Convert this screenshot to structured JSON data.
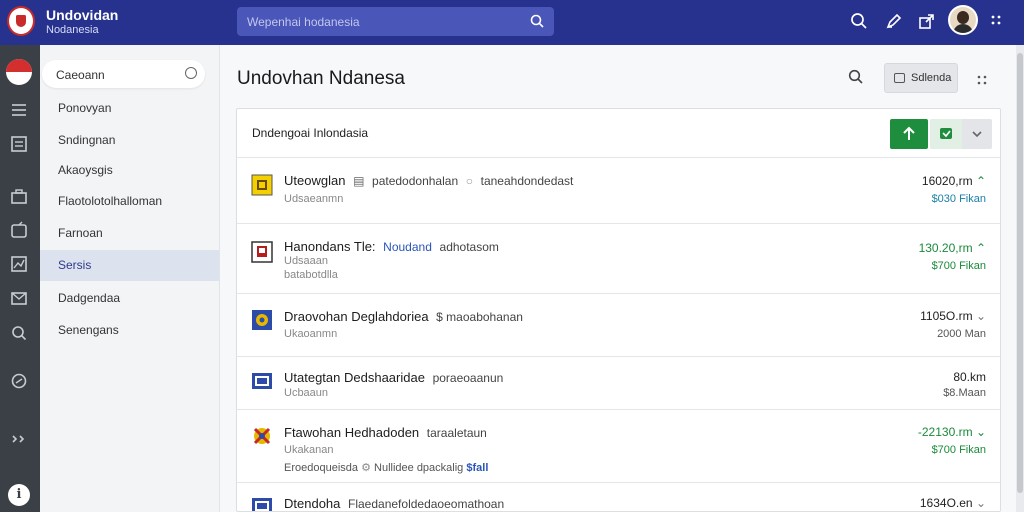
{
  "app": {
    "brand_line1": "Undovidan",
    "brand_line2": "Nodanesia"
  },
  "search": {
    "placeholder": "Wepenhai hodanesia"
  },
  "topbar_icons": [
    "search-icon",
    "edit-icon",
    "share-icon",
    "avatar",
    "apps-grid-icon"
  ],
  "rail_icons": [
    "flag-icon",
    "list-icon",
    "document-icon",
    "wallet-icon",
    "folder-icon",
    "chart-icon",
    "mail-icon",
    "search-icon",
    "settings-icon",
    "expand-icon",
    "info-icon"
  ],
  "nav": {
    "search_label": "Caeoann",
    "items": [
      {
        "label": "Ponovyan",
        "active": false
      },
      {
        "label": "Sndingnan",
        "active": false
      },
      {
        "label": "Akaoysgis",
        "active": false
      },
      {
        "label": "Flaotolotolhalloman",
        "active": false
      },
      {
        "label": "Farnoan",
        "active": false
      },
      {
        "label": "Sersis",
        "active": true
      },
      {
        "label": "Dadgendaa",
        "active": false
      },
      {
        "label": "Senengans",
        "active": false
      }
    ]
  },
  "main": {
    "title": "Undovhan Ndanesa",
    "action_button": "Sdlenda",
    "card_title": "Dndengoai Inlondasia",
    "rows": [
      {
        "name": "Uteowglan",
        "tag1": "patedodonhalan",
        "tag2": "taneahdondedast",
        "sub": "Udsaeanmn",
        "amount": "16020,rm",
        "amount_sub": "$030 Fikan",
        "trend": "up"
      },
      {
        "name": "Hanondans Tle:",
        "tag1": "Noudand",
        "tag2": "adhotasom",
        "sub": "Udsaaan",
        "sub_b": "batabotdlla",
        "amount": "130.20,rm",
        "amount_sub": "$700 Fikan",
        "trend": "up"
      },
      {
        "name": "Draovohan Deglahdoriea",
        "tag1": "$ maoabohanan",
        "sub": "Ukaoanmn",
        "amount": "1105O.rm",
        "amount_sub": "2000 Man",
        "trend": "down"
      },
      {
        "name": "Utategtan Dedshaaridae",
        "tag1": "poraeoaanun",
        "sub": "Ucbaaun",
        "amount": "80.km",
        "amount_sub": "$8.Maan",
        "trend": "none"
      },
      {
        "name": "Ftawohan Hedhadoden",
        "tag1": "taraaletaun",
        "sub": "Ukakanan",
        "sub3_text": "Eroedoqueisda",
        "sub3_mid": "Nullidee dpackalig",
        "sub3_blue": "$fall",
        "amount": "-22130.rm",
        "amount_sub": "$700 Fikan",
        "trend": "down"
      },
      {
        "name": "Dtendoha",
        "tag1": "Flaedanefoldedaoeomathoan",
        "amount": "1634O.en",
        "trend": "down"
      }
    ]
  },
  "colors": {
    "topbar": "#27328f",
    "rail": "#3b4047",
    "accent_green": "#1e8e3e",
    "nav_active": "#dde3ee"
  }
}
